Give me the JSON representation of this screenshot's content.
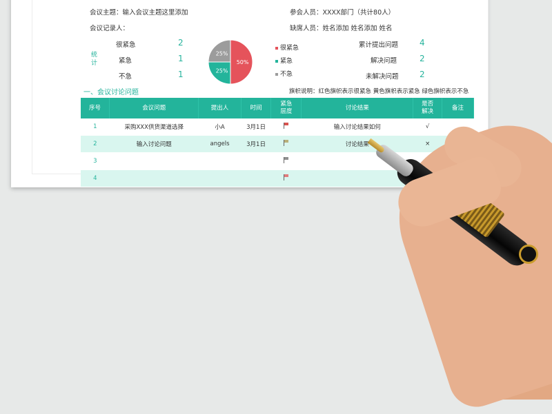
{
  "header": {
    "topic_label": "会议主题：",
    "topic_value": "输入会议主题这里添加",
    "recorder_label": "会议记录人：",
    "attendees_label": "参会人员：",
    "attendees_value": "XXXX部门（共计80人）",
    "absent_label": "缺席人员：",
    "absent_value": "姓名添加 姓名添加 姓名"
  },
  "stats": {
    "side_label": "统\n计",
    "rows": [
      {
        "label": "很紧急",
        "value": "2"
      },
      {
        "label": "紧急",
        "value": "1"
      },
      {
        "label": "不急",
        "value": "1"
      }
    ]
  },
  "pie": {
    "labels": [
      "25%",
      "25%",
      "50%"
    ],
    "legend": [
      "很紧急",
      "紧急",
      "不急"
    ],
    "colors": [
      "#e5535b",
      "#23b49b",
      "#9c9c9c"
    ]
  },
  "chart_data": {
    "type": "pie",
    "categories": [
      "很紧急",
      "紧急",
      "不急"
    ],
    "values": [
      50,
      25,
      25
    ]
  },
  "summary": [
    {
      "label": "累计提出问题",
      "value": "4"
    },
    {
      "label": "解决问题",
      "value": "2"
    },
    {
      "label": "未解决问题",
      "value": "2"
    }
  ],
  "section_title": "一、会议讨论问题",
  "flag_note": "旗帜说明：红色旗帜表示很紧急 黄色旗帜表示紧急 绿色旗帜表示不急",
  "table": {
    "headers": [
      "序号",
      "会议问题",
      "提出人",
      "时间",
      "紧急\n层度",
      "讨论结果",
      "是否\n解决",
      "备注"
    ],
    "rows": [
      {
        "seq": "1",
        "issue": "采购XXX供货渠道选择",
        "by": "小A",
        "time": "3月1日",
        "flag": "#d9534f",
        "result": "输入讨论结果如何",
        "solved": "√",
        "note": ""
      },
      {
        "seq": "2",
        "issue": "输入讨论问题",
        "by": "angels",
        "time": "3月1日",
        "flag": "#b9b07a",
        "result": "讨论结果",
        "solved": "×",
        "note": ""
      },
      {
        "seq": "3",
        "issue": "",
        "by": "",
        "time": "",
        "flag": "#8f8f8f",
        "result": "",
        "solved": "√",
        "note": ""
      },
      {
        "seq": "4",
        "issue": "",
        "by": "",
        "time": "",
        "flag": "#e07c7c",
        "result": "",
        "solved": "",
        "note": ""
      }
    ]
  }
}
